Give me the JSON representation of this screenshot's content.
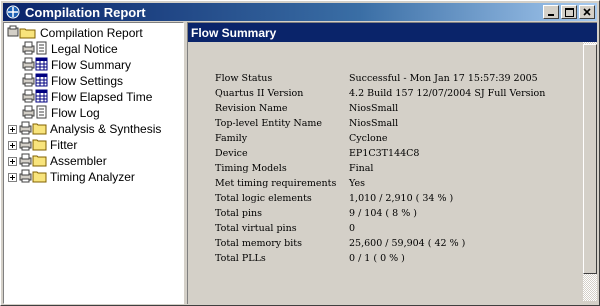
{
  "window": {
    "title": "Compilation Report",
    "icon": "quartus-app-icon",
    "buttons": [
      "minimize-icon",
      "maximize-icon",
      "close-icon"
    ]
  },
  "tree": {
    "items": [
      {
        "label": "Compilation Report",
        "icon": "report-folder-icon",
        "level": 0,
        "expandable": false
      },
      {
        "label": "Legal Notice",
        "icon": "printer-document-icon",
        "level": 1,
        "expandable": false
      },
      {
        "label": "Flow Summary",
        "icon": "printer-table-icon",
        "level": 1,
        "expandable": false
      },
      {
        "label": "Flow Settings",
        "icon": "printer-table-icon",
        "level": 1,
        "expandable": false
      },
      {
        "label": "Flow Elapsed Time",
        "icon": "printer-table-icon",
        "level": 1,
        "expandable": false
      },
      {
        "label": "Flow Log",
        "icon": "printer-document-icon",
        "level": 1,
        "expandable": false
      },
      {
        "label": "Analysis & Synthesis",
        "icon": "printer-folder-icon",
        "level": 0,
        "expandable": true
      },
      {
        "label": "Fitter",
        "icon": "printer-folder-icon",
        "level": 0,
        "expandable": true
      },
      {
        "label": "Assembler",
        "icon": "printer-folder-icon",
        "level": 0,
        "expandable": true
      },
      {
        "label": "Timing Analyzer",
        "icon": "printer-folder-icon",
        "level": 0,
        "expandable": true
      }
    ]
  },
  "content": {
    "header": "Flow Summary",
    "rows": [
      {
        "label": "Flow Status",
        "value": "Successful - Mon Jan 17 15:57:39 2005"
      },
      {
        "label": "Quartus II Version",
        "value": "4.2 Build 157 12/07/2004 SJ Full Version"
      },
      {
        "label": "Revision Name",
        "value": "NiosSmall"
      },
      {
        "label": "Top-level Entity Name",
        "value": "NiosSmall"
      },
      {
        "label": "Family",
        "value": "Cyclone"
      },
      {
        "label": "Device",
        "value": "EP1C3T144C8"
      },
      {
        "label": "Timing Models",
        "value": "Final"
      },
      {
        "label": "Met timing requirements",
        "value": "Yes"
      },
      {
        "label": "Total logic elements",
        "value": "1,010 / 2,910 ( 34 % )"
      },
      {
        "label": "Total pins",
        "value": "9 / 104 ( 8 % )"
      },
      {
        "label": "Total virtual pins",
        "value": "0"
      },
      {
        "label": "Total memory bits",
        "value": "25,600 / 59,904 ( 42 % )"
      },
      {
        "label": "Total PLLs",
        "value": "0 / 1 ( 0 % )"
      }
    ]
  },
  "colors": {
    "titlebar_start": "#0a246a",
    "titlebar_end": "#a6caf0",
    "header_bg": "#0a246a",
    "face": "#d4d0c8"
  }
}
